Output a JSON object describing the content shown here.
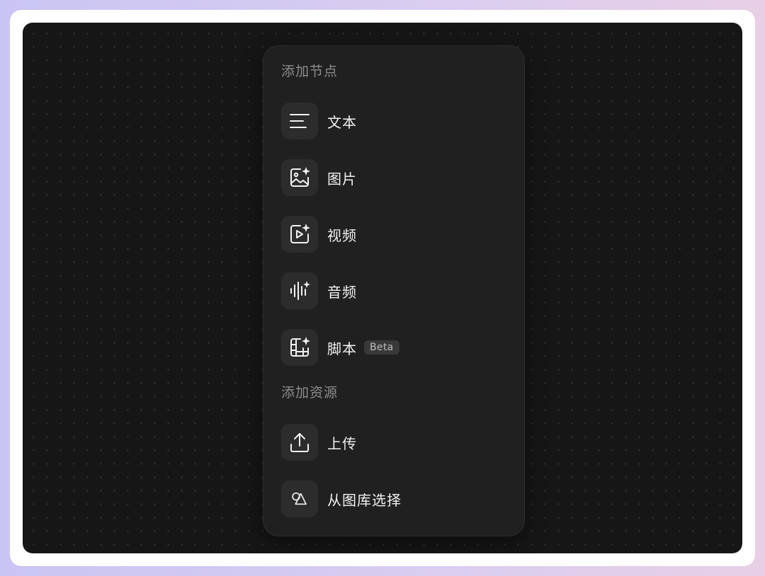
{
  "panel": {
    "section_add_node": "添加节点",
    "section_add_resource": "添加资源",
    "node_items": [
      {
        "label": "文本",
        "icon": "text-lines-icon"
      },
      {
        "label": "图片",
        "icon": "image-sparkle-icon"
      },
      {
        "label": "视频",
        "icon": "video-sparkle-icon"
      },
      {
        "label": "音频",
        "icon": "audio-wave-icon"
      },
      {
        "label": "脚本",
        "icon": "script-film-icon",
        "badge": "Beta"
      }
    ],
    "resource_items": [
      {
        "label": "上传",
        "icon": "upload-icon"
      },
      {
        "label": "从图库选择",
        "icon": "library-shapes-icon"
      }
    ]
  },
  "colors": {
    "canvas_bg": "#161616",
    "panel_bg": "#202020",
    "icon_box_bg": "#2c2c2c",
    "section_title": "#8c8c8c",
    "label_text": "#f2f2f2",
    "badge_bg": "#393939"
  }
}
